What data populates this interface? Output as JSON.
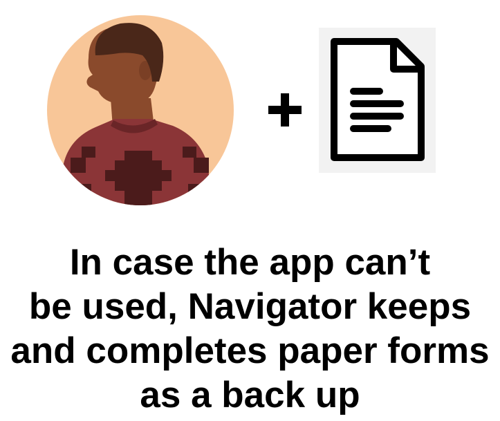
{
  "icons": {
    "avatar": "person-avatar-icon",
    "plus": "plus-icon",
    "document": "paper-form-icon"
  },
  "colors": {
    "avatar_bg": "#f8c698",
    "skin": "#8a4a2c",
    "hair": "#4a2719",
    "sweater": "#8b3537",
    "sweater_pattern": "#4b1b1b",
    "doc_tile_bg": "#f2f2f2",
    "ink": "#000000"
  },
  "caption": {
    "lines": [
      "In case the app can’t",
      "be used, Navigator keeps",
      "and completes paper forms",
      "as a back up"
    ]
  }
}
